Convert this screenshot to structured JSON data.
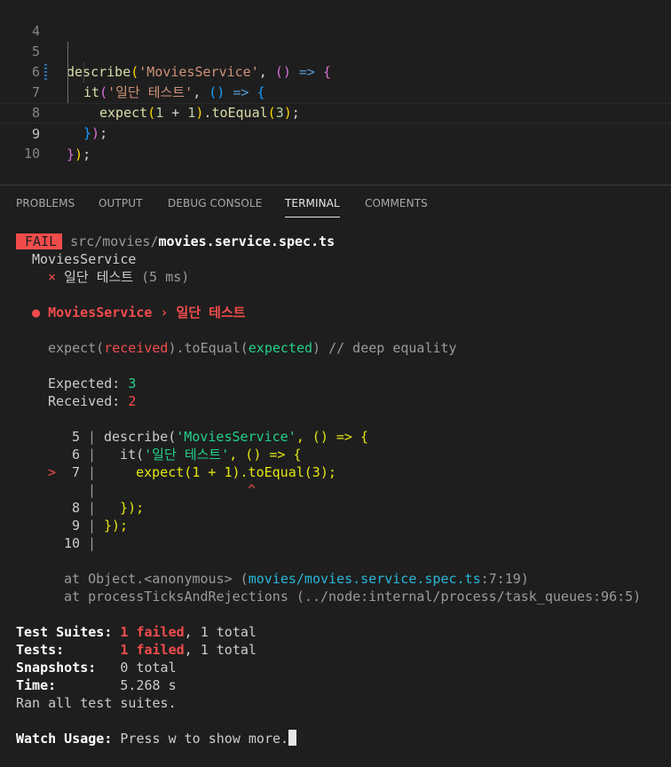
{
  "editor": {
    "lines": [
      {
        "num": "4"
      },
      {
        "num": "5",
        "p1": "describe",
        "p2": "(",
        "p3": "'MoviesService'",
        "p4": ", ",
        "p5": "()",
        "p6": " => ",
        "p7": "{"
      },
      {
        "num": "6",
        "p1": "it",
        "p2": "(",
        "p3": "'일단 테스트'",
        "p4": ", ",
        "p5": "()",
        "p6": " => ",
        "p7": "{"
      },
      {
        "num": "7",
        "p1": "expect",
        "p2": "(",
        "p3": "1",
        "p4": " + ",
        "p5": "1",
        "p6": ")",
        "p7": ".",
        "p8": "toEqual",
        "p9": "(",
        "p10": "3",
        "p11": ")",
        "p12": ";"
      },
      {
        "num": "8",
        "p1": "}",
        "p2": ")",
        "p3": ";"
      },
      {
        "num": "9",
        "p1": "}",
        "p2": ")",
        "p3": ";"
      },
      {
        "num": "10"
      }
    ]
  },
  "panel": {
    "tabs": [
      {
        "label": "PROBLEMS"
      },
      {
        "label": "OUTPUT"
      },
      {
        "label": "DEBUG CONSOLE"
      },
      {
        "label": "TERMINAL"
      },
      {
        "label": "COMMENTS"
      }
    ],
    "active_tab": "TERMINAL"
  },
  "terminal": {
    "fail_badge": "FAIL",
    "path_dir": "src/movies/",
    "path_file": "movies.service.spec.ts",
    "suite": "MoviesService",
    "test_mark": "×",
    "test_name": "일단 테스트",
    "test_time": "(5 ms)",
    "error_title_bullet": "●",
    "error_title": "MoviesService › 일단 테스트",
    "matcher": {
      "a": "expect(",
      "b": "received",
      "c": ").toEqual(",
      "d": "expected",
      "e": ") // deep equality"
    },
    "expected_label": "Expected: ",
    "expected_value": "3",
    "received_label": "Received: ",
    "received_value": "2",
    "snippet_marker": ">",
    "snippet": [
      {
        "n": "5",
        "a": "describe(",
        "b": "'MoviesService'",
        "c": ", () => {"
      },
      {
        "n": "6",
        "a": "  it(",
        "b": "'일단 테스트'",
        "c": ", () => {"
      },
      {
        "n": "7",
        "a": "    expect(1 + 1).toEqual(3);"
      },
      {
        "n": "",
        "a": "",
        "caret": "^"
      },
      {
        "n": "8",
        "a": "  });"
      },
      {
        "n": "9",
        "a": "});"
      },
      {
        "n": "10",
        "a": ""
      }
    ],
    "stack": [
      {
        "a": "at Object.<anonymous> (",
        "b": "movies/movies.service.spec.ts",
        "c": ":7:19)"
      },
      {
        "a": "at processTicksAndRejections (../node:internal/process/task_queues:96:5)"
      }
    ],
    "summary": {
      "suites_label": "Test Suites: ",
      "suites_failed": "1 failed",
      "suites_total": ", 1 total",
      "tests_label": "Tests:       ",
      "tests_failed": "1 failed",
      "tests_total": ", 1 total",
      "snap_label": "Snapshots:   ",
      "snap_value": "0 total",
      "time_label": "Time:        ",
      "time_value": "5.268 s",
      "ran": "Ran all test suites."
    },
    "watch_label": "Watch Usage: ",
    "watch_text": "Press w to show more."
  }
}
